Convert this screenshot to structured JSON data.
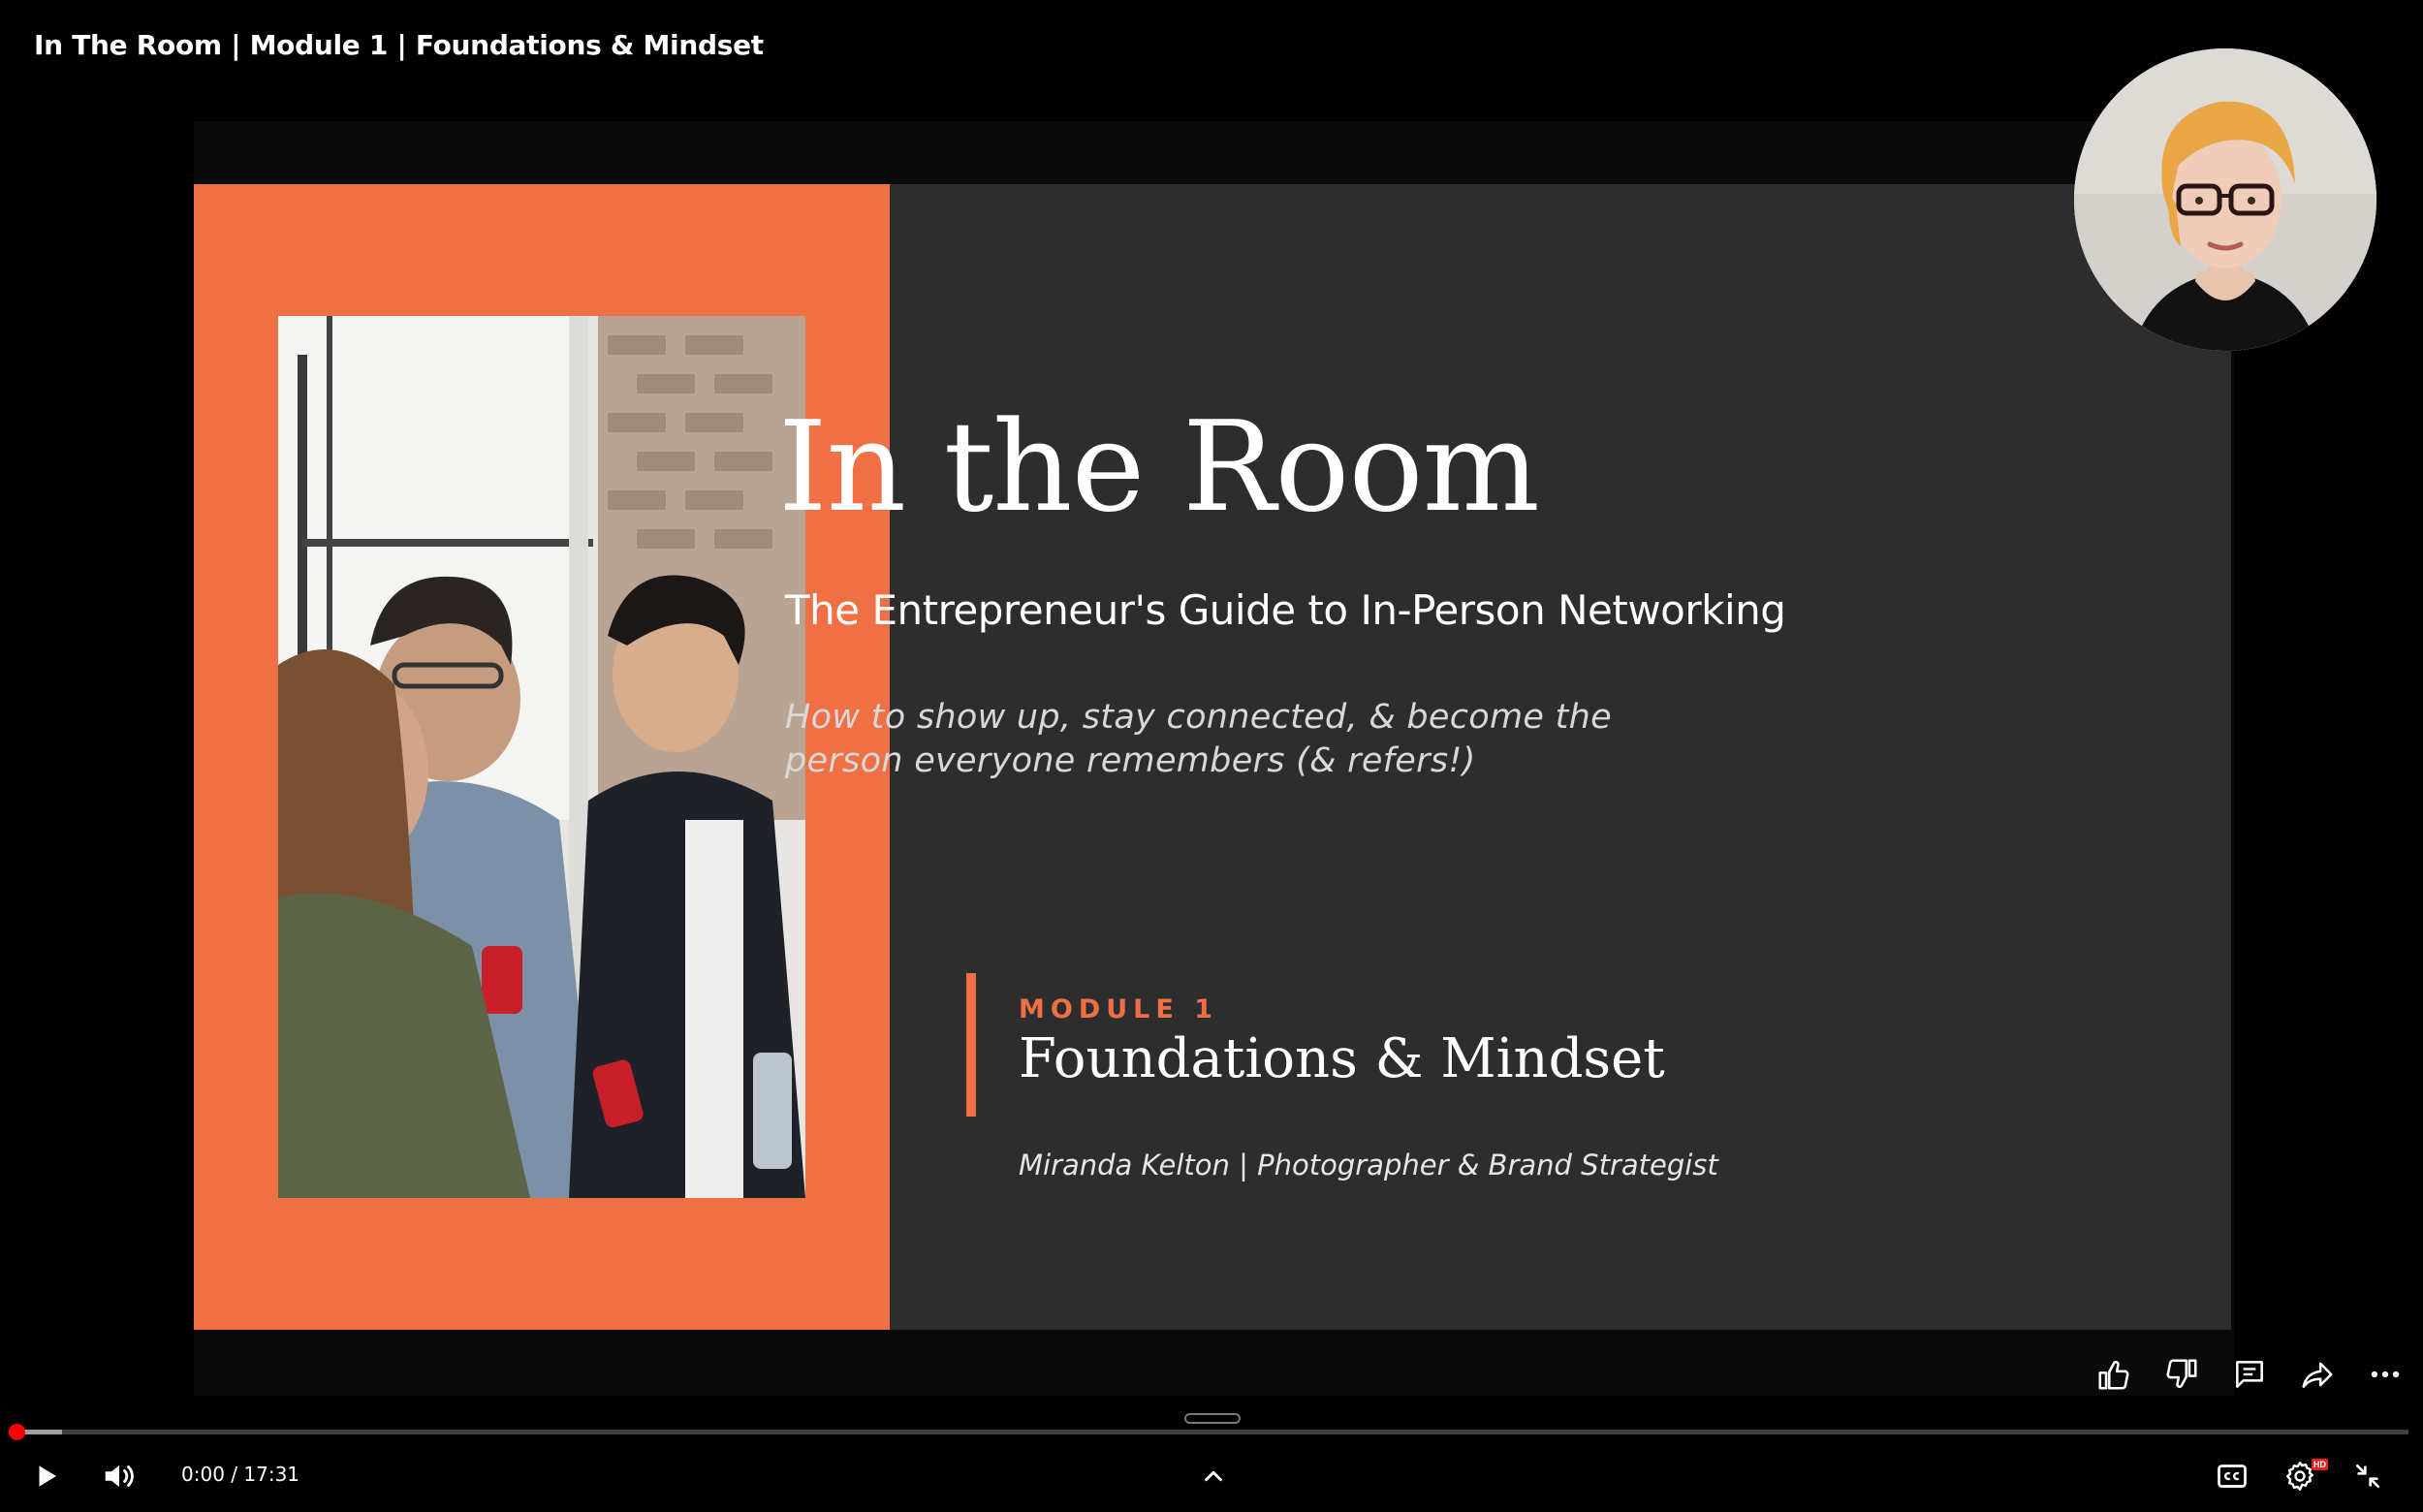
{
  "video": {
    "title": "In The Room | Module 1 | Foundations & Mindset",
    "time_current": "0:00",
    "time_total": "17:31",
    "progress_played_fraction": 0.0,
    "progress_buffered_fraction": 0.016,
    "quality_badge": "HD"
  },
  "slide": {
    "title": "In the Room",
    "subtitle": "The Entrepreneur's Guide to In-Person Networking",
    "tagline": "How to show up, stay connected, & become the person everyone remembers (& refers!)",
    "module_label": "MODULE 1",
    "module_name": "Foundations & Mindset",
    "author": "Miranda Kelton | Photographer & Brand Strategist",
    "accent_color": "#f07046",
    "background_color": "#2d2d2d"
  },
  "actions": [
    {
      "name": "like",
      "icon": "thumbs-up-icon"
    },
    {
      "name": "dislike",
      "icon": "thumbs-down-icon"
    },
    {
      "name": "comments",
      "icon": "comment-icon"
    },
    {
      "name": "share",
      "icon": "share-icon"
    },
    {
      "name": "more",
      "icon": "more-horizontal-icon"
    }
  ],
  "controls": {
    "play_icon": "play-icon",
    "volume_icon": "volume-icon",
    "expand_icon": "chevron-up-icon",
    "captions_icon": "captions-icon",
    "settings_icon": "gear-icon",
    "exit_fullscreen_icon": "exit-fullscreen-icon"
  }
}
